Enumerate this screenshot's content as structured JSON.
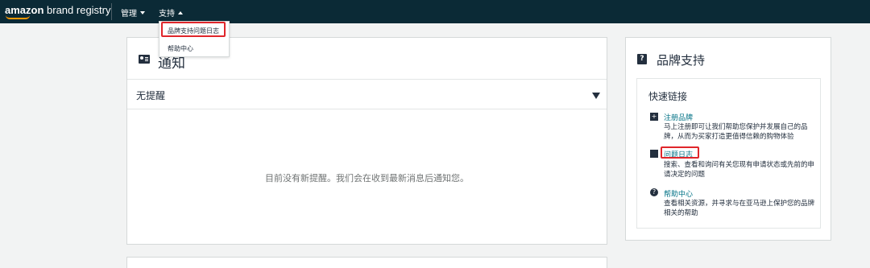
{
  "header": {
    "logo_brand": "amazon",
    "logo_product": " brand registry",
    "nav_manage": "管理",
    "nav_support": "支持"
  },
  "dropdown": {
    "items": [
      {
        "label": "品牌支持问题日志"
      },
      {
        "label": "帮助中心"
      }
    ]
  },
  "notice": {
    "title": "通知",
    "filter_label": "无提醒",
    "empty_message": "目前没有新提醒。我们会在收到最新消息后通知您。"
  },
  "support": {
    "icon": "?",
    "title": "品牌支持",
    "quick_links_title": "快速链接",
    "links": [
      {
        "icon": "add-folder-icon",
        "label": "注册品牌",
        "desc": "马上注册即可让我们帮助您保护并发展自己的品牌，从而为买家打造更值得信赖的购物体验"
      },
      {
        "icon": "briefcase-icon",
        "label": "问题日志",
        "desc": "搜索、查看和询问有关您现有申请状态或先前的申请决定的问题"
      },
      {
        "icon": "question-circle-icon",
        "label": "帮助中心",
        "desc": "查看相关资源，并寻求与在亚马逊上保护您的品牌相关的帮助"
      }
    ]
  },
  "colors": {
    "topbar": "#0b2a36",
    "link": "#007185",
    "highlight": "#e0262b",
    "accent": "#ff9900"
  }
}
